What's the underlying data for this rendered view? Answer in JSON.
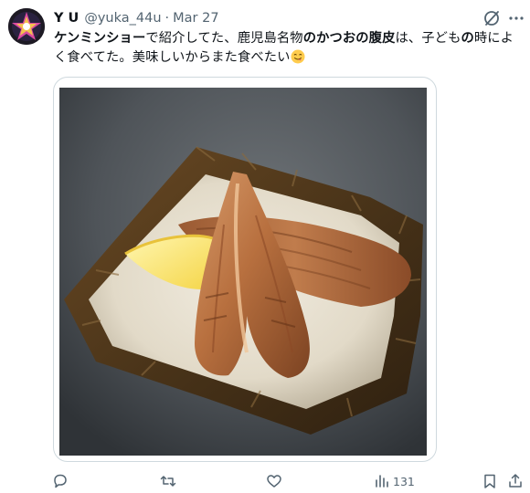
{
  "tweet": {
    "display_name": "Y U",
    "handle": "@yuka_44u",
    "separator": "·",
    "date": "Mar 27",
    "text": {
      "part1_bold": "ケンミンショー",
      "part2": "で紹介してた、鹿児島名物",
      "part3_bold": "のかつおの腹皮",
      "part4": "は、子ども",
      "part5_bold": "の",
      "part6": "時によく食べてた。美味しいからまた食べたい"
    },
    "emoji": "face-savoring-food",
    "media": {
      "icon": "photo-grilled-bonito-belly-on-plate"
    },
    "metrics": {
      "views": "131"
    },
    "icons": {
      "grok": "grok-icon",
      "more": "more-icon",
      "reply": "reply-icon",
      "retweet": "retweet-icon",
      "like": "like-icon",
      "views": "views-icon",
      "bookmark": "bookmark-icon",
      "share": "share-icon"
    }
  }
}
